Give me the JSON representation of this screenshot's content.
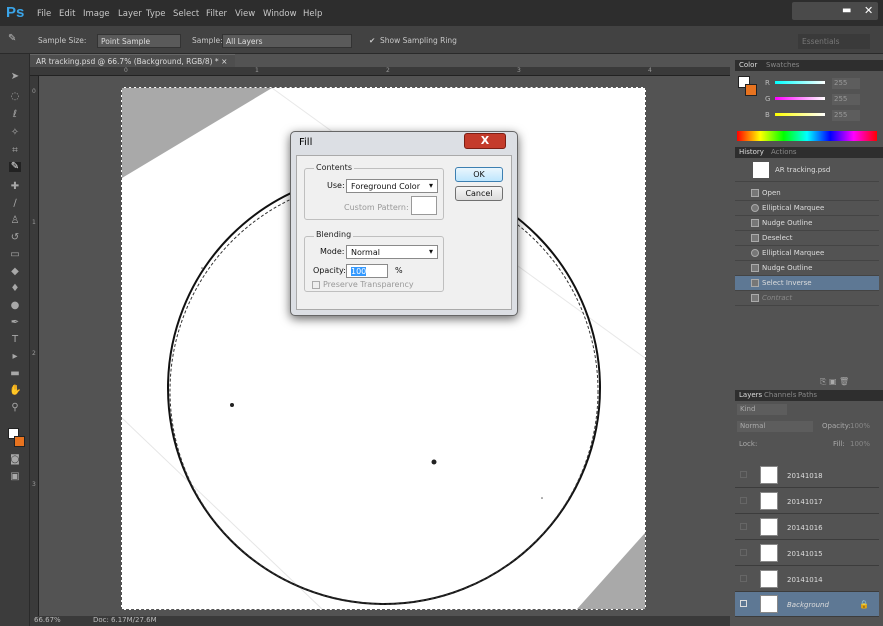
{
  "app": {
    "logo": "Ps"
  },
  "menu": [
    "File",
    "Edit",
    "Image",
    "Layer",
    "Type",
    "Select",
    "Filter",
    "View",
    "Window",
    "Help"
  ],
  "options": {
    "sample_size_label": "Sample Size:",
    "sample_size_value": "Point Sample",
    "sample_label": "Sample:",
    "sample_value": "All Layers",
    "show_ring": "Show Sampling Ring",
    "workspace": "Essentials"
  },
  "document": {
    "tab_title": "AR tracking.psd @ 66.7% (Background, RGB/8) *",
    "ruler_top": [
      "0",
      "1",
      "2",
      "3",
      "4"
    ],
    "ruler_left": [
      "0",
      "1",
      "2",
      "3"
    ],
    "zoom": "66.67%",
    "doc_size": "Doc: 6.17M/27.6M"
  },
  "dialog": {
    "title": "Fill",
    "close": "X",
    "contents_label": "Contents",
    "use_label": "Use:",
    "use_value": "Foreground Color",
    "custom_pattern": "Custom Pattern:",
    "blending_label": "Blending",
    "mode_label": "Mode:",
    "mode_value": "Normal",
    "opacity_label": "Opacity:",
    "opacity_value": "100",
    "opacity_unit": "%",
    "preserve": "Preserve Transparency",
    "ok": "OK",
    "cancel": "Cancel"
  },
  "color_panel": {
    "tabs": [
      "Color",
      "Swatches"
    ],
    "r": "255",
    "g": "255",
    "b": "255",
    "r_label": "R",
    "g_label": "G",
    "b_label": "B"
  },
  "history_panel": {
    "tabs": [
      "History",
      "Actions"
    ],
    "snapshot": "AR tracking.psd",
    "items": [
      "Open",
      "Elliptical Marquee",
      "Nudge Outline",
      "Deselect",
      "Elliptical Marquee",
      "Nudge Outline",
      "Select Inverse",
      "Contract"
    ]
  },
  "layers_panel": {
    "tabs": [
      "Layers",
      "Channels",
      "Paths"
    ],
    "kind": "Kind",
    "blend": "Normal",
    "opacity_label": "Opacity:",
    "opacity_value": "100%",
    "lock_label": "Lock:",
    "fill_label": "Fill:",
    "fill_value": "100%",
    "layers": [
      "20141018",
      "20141017",
      "20141016",
      "20141015",
      "20141014",
      "Background"
    ]
  },
  "colors": {
    "fg": "#ffffff",
    "bg": "#e8731f",
    "accent": "#3aa4e8"
  }
}
